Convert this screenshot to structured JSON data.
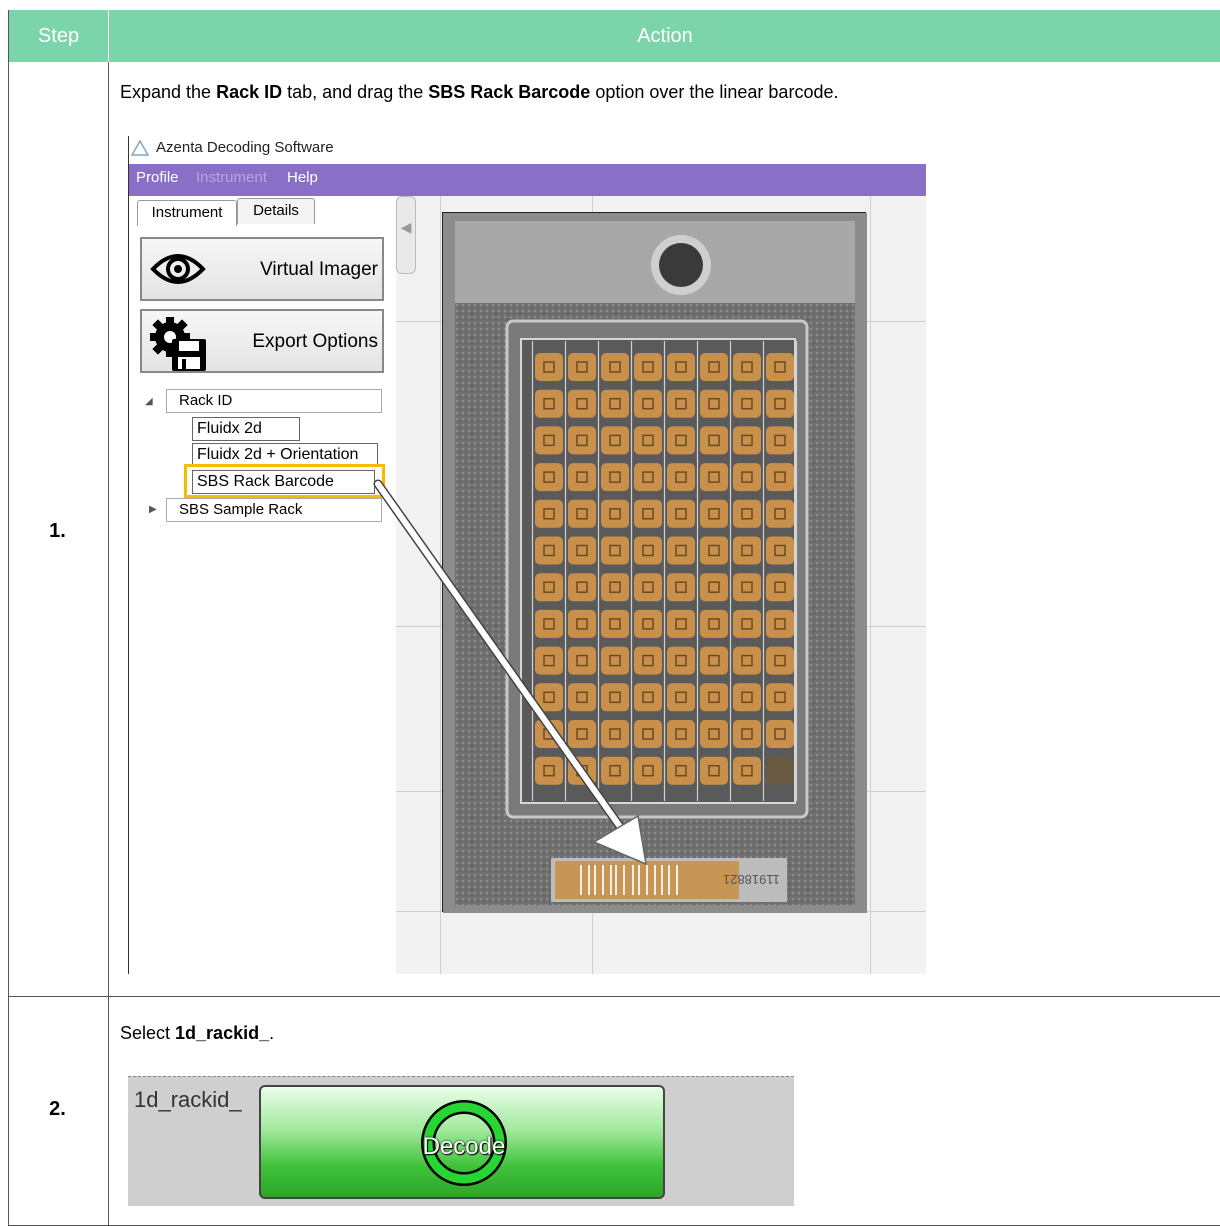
{
  "table": {
    "header_step": "Step",
    "header_action": "Action"
  },
  "rows": [
    {
      "step": "1.",
      "instruction": {
        "pre": "Expand the ",
        "b1": "Rack ID",
        "mid": " tab, and drag the ",
        "b2": "SBS Rack Barcode",
        "post": " option over the linear barcode."
      }
    },
    {
      "step": "2.",
      "instruction": {
        "pre": "Select ",
        "b1": "1d_rackid_",
        "post": "."
      }
    }
  ],
  "app": {
    "title": "Azenta Decoding Software",
    "menu": [
      "Profile",
      "Instrument",
      "Help"
    ],
    "tabs": [
      "Instrument",
      "Details"
    ],
    "buttons": {
      "virtual_imager": "Virtual Imager",
      "export_options": "Export Options"
    },
    "tree": {
      "rack_id": "Rack ID",
      "children": [
        "Fluidx 2d",
        "Fluidx 2d + Orientation",
        "SBS Rack Barcode"
      ],
      "sbs_sample_rack": "SBS Sample Rack"
    },
    "barcode_number": "11918821"
  },
  "decode": {
    "label": "1d_rackid_",
    "button": "Decode"
  },
  "colors": {
    "header": "#7cd4aa",
    "menubar": "#8a6fc7",
    "highlight": "#f4be00",
    "tube_overlay": "#c8904a"
  }
}
